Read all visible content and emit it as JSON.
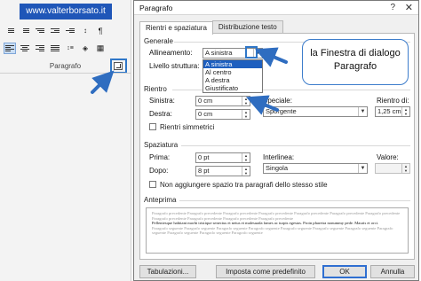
{
  "banner": {
    "text": "www.valterborsato.it"
  },
  "ribbon": {
    "group_label": "Paragrafo",
    "launcher_icon": "dialog-launcher-icon"
  },
  "dialog": {
    "title": "Paragrafo",
    "help": "?",
    "close": "✕",
    "tabs": [
      {
        "label": "Rientri e spaziatura",
        "active": true
      },
      {
        "label": "Distribuzione testo",
        "active": false
      }
    ],
    "generale": {
      "section": "Generale",
      "allineamento_label": "Allineamento:",
      "allineamento_value": "A sinistra",
      "dropdown_options": [
        "A sinistra",
        "Al centro",
        "A destra",
        "Giustificato"
      ],
      "livello_label": "Livello struttura:"
    },
    "rientro": {
      "section": "Rientro",
      "sinistra_label": "Sinistra:",
      "sinistra_value": "0 cm",
      "destra_label": "Destra:",
      "destra_value": "0 cm",
      "speciale_label": "Speciale:",
      "speciale_value": "Sporgente",
      "rientro_di_label": "Rientro di:",
      "rientro_di_value": "1,25 cm",
      "simmetrici_label": "Rientri simmetrici"
    },
    "spaziatura": {
      "section": "Spaziatura",
      "prima_label": "Prima:",
      "prima_value": "0 pt",
      "dopo_label": "Dopo:",
      "dopo_value": "8 pt",
      "interlinea_label": "Interlinea:",
      "interlinea_value": "Singola",
      "valore_label": "Valore:",
      "non_aggiungere_label": "Non aggiungere spazio tra paragrafi dello stesso stile"
    },
    "anteprima": {
      "section": "Anteprima",
      "prev_text": "Paragrafo precedente Paragrafo precedente Paragrafo precedente Paragrafo precedente Paragrafo precedente Paragrafo precedente Paragrafo precedente Paragrafo precedente Paragrafo precedente Paragrafo precedente Paragrafo precedente",
      "main_text": "Pellentesque habitant morbi tristique senectus et netus et malesuada fames ac turpis egestas. Proin pharetra nonummy pede. Mauris et orci.",
      "next_text": "Paragrafo seguente Paragrafo seguente Paragrafo seguente Paragrafo seguente Paragrafo seguente Paragrafo seguente Paragrafo seguente Paragrafo seguente Paragrafo seguente Paragrafo seguente Paragrafo seguente"
    },
    "buttons": {
      "tabulazioni": "Tabulazioni...",
      "predefinito": "Imposta come predefinito",
      "ok": "OK",
      "annulla": "Annulla"
    }
  },
  "callout": {
    "line1": "la Finestra di dialogo",
    "line2": "Paragrafo"
  },
  "colors": {
    "banner_bg": "#1f56b8",
    "accent_blue": "#2f77c8",
    "selection": "#1e5fbf"
  }
}
